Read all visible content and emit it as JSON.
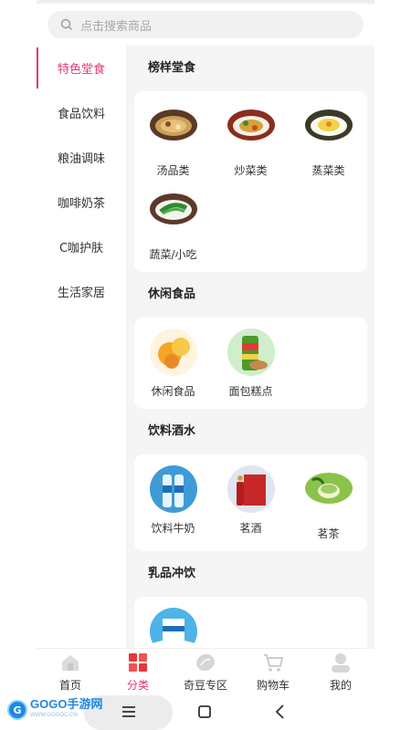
{
  "search": {
    "placeholder": "点击搜索商品"
  },
  "sidebar": {
    "items": [
      {
        "label": "特色堂食",
        "active": true
      },
      {
        "label": "食品饮料"
      },
      {
        "label": "粮油调味"
      },
      {
        "label": "咖啡奶茶"
      },
      {
        "label": "C咖护肤"
      },
      {
        "label": "生活家居"
      }
    ]
  },
  "sections": [
    {
      "title": "榜样堂食",
      "items": [
        {
          "label": "汤品类",
          "icon": "soup-photo"
        },
        {
          "label": "炒菜类",
          "icon": "stir-fry-photo"
        },
        {
          "label": "蒸菜类",
          "icon": "steamed-dish-photo"
        },
        {
          "label": "蔬菜/小吃",
          "icon": "vegetable-photo"
        }
      ]
    },
    {
      "title": "休闲食品",
      "items": [
        {
          "label": "休闲食品",
          "icon": "snack-photo"
        },
        {
          "label": "面包糕点",
          "icon": "chips-can-photo"
        }
      ]
    },
    {
      "title": "饮料酒水",
      "items": [
        {
          "label": "饮料牛奶",
          "icon": "water-bottles-photo"
        },
        {
          "label": "茗酒",
          "icon": "liquor-box-photo"
        },
        {
          "label": "茗茶",
          "icon": "tea-cup-photo"
        }
      ]
    },
    {
      "title": "乳品冲饮",
      "items": [
        {
          "label": "",
          "icon": "milk-box-photo"
        }
      ]
    }
  ],
  "tabbar": {
    "items": [
      {
        "label": "首页",
        "icon": "home-icon"
      },
      {
        "label": "分类",
        "icon": "category-icon",
        "active": true
      },
      {
        "label": "奇豆专区",
        "icon": "bean-icon"
      },
      {
        "label": "购物车",
        "icon": "cart-icon"
      },
      {
        "label": "我的",
        "icon": "profile-icon"
      }
    ]
  },
  "watermark": {
    "brand": "GOGO手游网",
    "sub": "WWW.GOGOC.CN",
    "logo": "G"
  },
  "colors": {
    "accent": "#e5357a",
    "page_bg": "#f5f5f5"
  }
}
